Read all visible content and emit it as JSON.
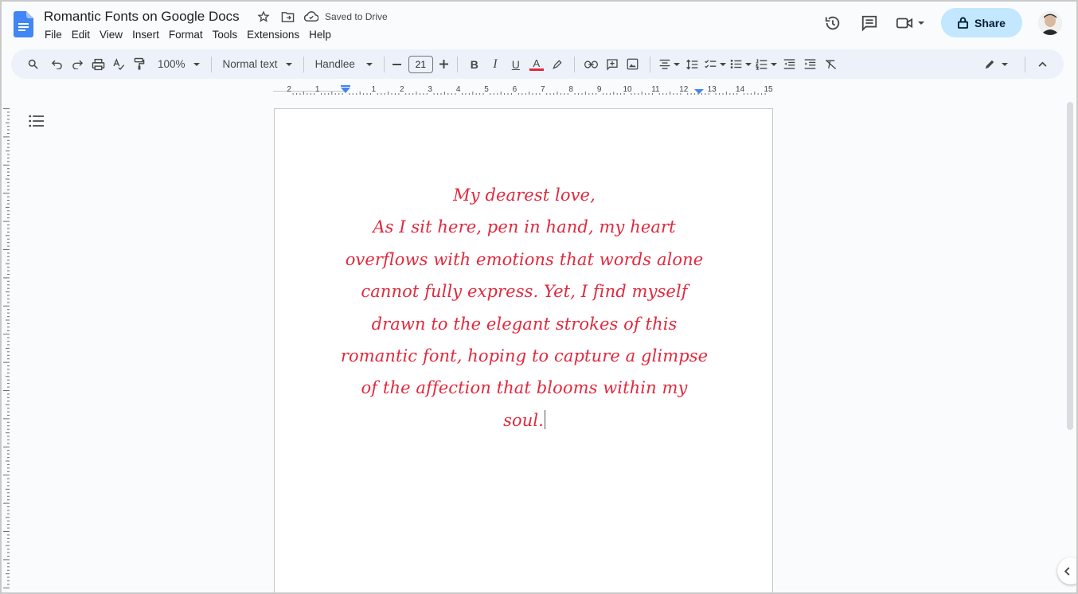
{
  "window": {
    "title": "Romantic Fonts on Google Docs",
    "save_status": "Saved to Drive"
  },
  "menu": [
    "File",
    "Edit",
    "View",
    "Insert",
    "Format",
    "Tools",
    "Extensions",
    "Help"
  ],
  "header_actions": {
    "share_label": "Share"
  },
  "toolbar": {
    "zoom": "100%",
    "style": "Normal text",
    "font": "Handlee",
    "font_size": "21"
  },
  "ruler": {
    "labels": [
      "2",
      "1",
      "1",
      "2",
      "3",
      "4",
      "5",
      "6",
      "7",
      "8",
      "9",
      "10",
      "11",
      "12",
      "13",
      "14",
      "15"
    ]
  },
  "document": {
    "lines": [
      "My dearest love,",
      "As I sit here, pen in hand, my heart",
      "overflows with emotions that words alone",
      "cannot fully express. Yet, I find myself",
      "drawn to the elegant strokes of this",
      "romantic font, hoping to capture a glimpse",
      "of the affection that blooms within my",
      "soul."
    ],
    "text_color": "#e2283d"
  },
  "colors": {
    "share_bg": "#c2e7ff",
    "toolbar_bg": "#edf2fa",
    "doc_blue": "#4285f4"
  }
}
